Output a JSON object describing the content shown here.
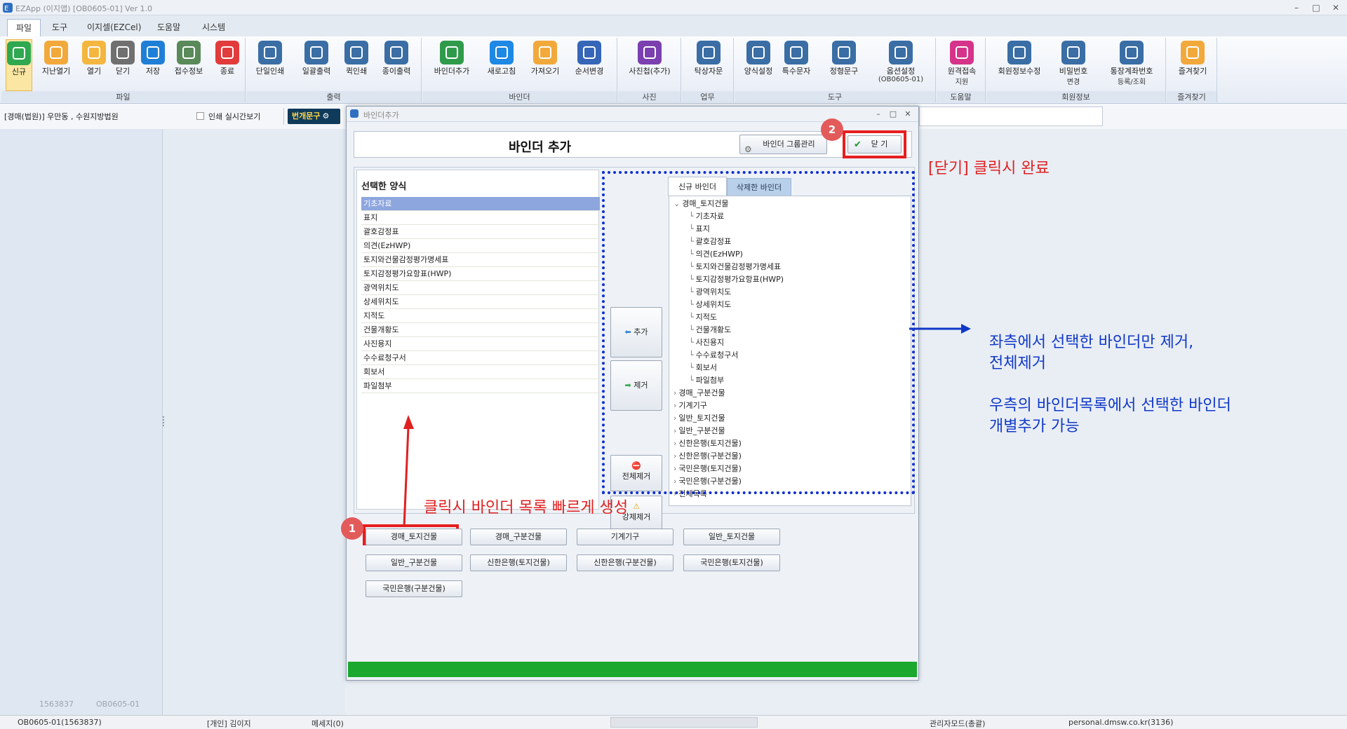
{
  "window": {
    "title": "EZApp (이지앱) [OB0605-01] Ver 1.0",
    "min": "–",
    "max": "□",
    "close": "✕"
  },
  "menu": [
    "파일",
    "도구",
    "이지셀(EZCel)",
    "도움말",
    "시스템"
  ],
  "ribbon": {
    "groups": [
      "파일",
      "출력",
      "바인더",
      "사진",
      "업무",
      "도구",
      "도움말",
      "회원정보",
      "즐겨찾기"
    ],
    "buttons": [
      {
        "label": "신규",
        "icon": "plus-icon",
        "color": "#2fa84f"
      },
      {
        "label": "지난열기",
        "icon": "folder-history-icon",
        "color": "#f2a93b"
      },
      {
        "label": "열기",
        "icon": "folder-open-icon",
        "color": "#f4b63f"
      },
      {
        "label": "닫기",
        "icon": "close-x-icon",
        "color": "#707070"
      },
      {
        "label": "저장",
        "icon": "save-icon",
        "color": "#1f7fd6"
      },
      {
        "label": "접수정보",
        "icon": "receipt-icon",
        "color": "#5a8a5a"
      },
      {
        "label": "종료",
        "icon": "power-icon",
        "color": "#e23b3b"
      },
      {
        "label": "단일인쇄",
        "icon": "printer-icon",
        "color": "#3a6ea5"
      },
      {
        "label": "일괄출력",
        "icon": "printer-all-icon",
        "color": "#3a6ea5"
      },
      {
        "label": "퀵인쇄",
        "icon": "quick-print-icon",
        "color": "#3a6ea5"
      },
      {
        "label": "종이출력",
        "icon": "paper-print-icon",
        "color": "#3a6ea5"
      },
      {
        "label": "바인더추가",
        "icon": "binder-add-icon",
        "color": "#2f9b4a"
      },
      {
        "label": "새로고침",
        "icon": "refresh-icon",
        "color": "#1e88e5"
      },
      {
        "label": "가져오기",
        "icon": "import-arrow-icon",
        "color": "#f2a93b"
      },
      {
        "label": "순서변경",
        "icon": "reorder-icon",
        "color": "#3566b8"
      },
      {
        "label": "사진첩(추가)",
        "icon": "photo-album-icon",
        "color": "#7b3fb0"
      },
      {
        "label": "탁상자문",
        "icon": "people-icon",
        "color": "#3a6ea5"
      },
      {
        "label": "양식설정",
        "icon": "form-settings-icon",
        "color": "#3a6ea5"
      },
      {
        "label": "특수문자",
        "icon": "special-char-icon",
        "color": "#3a6ea5"
      },
      {
        "label": "정형문구",
        "icon": "template-text-icon",
        "color": "#3a6ea5"
      },
      {
        "label": "옵션설정",
        "sub": "(OB0605-01)",
        "icon": "option-settings-icon",
        "color": "#3a6ea5"
      },
      {
        "label": "원격접속",
        "sub": "지원",
        "icon": "remote-support-icon",
        "color": "#d6338a"
      },
      {
        "label": "회원정보수정",
        "icon": "member-edit-icon",
        "color": "#3a6ea5"
      },
      {
        "label": "비밀번호",
        "sub": "변경",
        "icon": "password-change-icon",
        "color": "#3a6ea5"
      },
      {
        "label": "통장계좌번호",
        "sub": "등록/조회",
        "icon": "bank-account-icon",
        "color": "#3a6ea5"
      },
      {
        "label": "즐겨찾기",
        "icon": "star-icon",
        "color": "#f2a93b"
      }
    ]
  },
  "info_row": {
    "case_text": "[경매(법원)] 우만동 , 수원지방법원",
    "realtime_print_label": "인쇄 실시간보기",
    "tag_button": "번개문구"
  },
  "left_panel": {
    "footer_left": "1563837",
    "footer_right": "OB0605-01"
  },
  "status_bar": [
    "OB0605-01(1563837)",
    "[개인] 김이지",
    "메세지(0)",
    "관리자모드(총괄)",
    "personal.dmsw.co.kr(3136)"
  ],
  "dialog": {
    "window_title": "바인더추가",
    "header_title": "바인더 추가",
    "group_manage_button": "바인더 그룹관리",
    "close_button": "닫   기",
    "selected_forms_title": "선택한 양식",
    "selected_forms": [
      "기초자료",
      "표지",
      "괄호감정표",
      "의견(EzHWP)",
      "토지와건물감정평가명세표",
      "토지감정평가요항표(HWP)",
      "광역위치도",
      "상세위치도",
      "지적도",
      "건물개황도",
      "사진용지",
      "수수료청구서",
      "회보서",
      "파일첨부"
    ],
    "add_button": "추가",
    "remove_button": "제거",
    "remove_all_button": "전체제거",
    "force_remove_button": "강제제거",
    "tabs": [
      "신규 바인더",
      "삭제한 바인더"
    ],
    "tree_root": "경매_토지건물",
    "tree_children": [
      "기초자료",
      "표지",
      "괄호감정표",
      "의견(EzHWP)",
      "토지와건물감정평가명세표",
      "토지감정평가요항표(HWP)",
      "광역위치도",
      "상세위치도",
      "지적도",
      "건물개황도",
      "사진용지",
      "수수료청구서",
      "회보서",
      "파일첨부"
    ],
    "tree_collapsed": [
      "경매_구분건물",
      "기계기구",
      "일반_토지건물",
      "일반_구분건물",
      "신한은행(토지건물)",
      "신한은행(구분건물)",
      "국민은행(토지건물)",
      "국민은행(구분건물)",
      "전체목록"
    ],
    "quick_buttons": [
      "경매_토지건물",
      "경매_구분건물",
      "기계기구",
      "일반_토지건물",
      "일반_구분건물",
      "신한은행(토지건물)",
      "신한은행(구분건물)",
      "국민은행(토지건물)",
      "국민은행(구분건물)"
    ]
  },
  "annotations": {
    "badge1": "1",
    "badge2": "2",
    "close_note": "[닫기] 클릭시 완료",
    "click_note": "클릭시 바인더 목록 빠르게 생성",
    "right_note_line1": "좌측에서 선택한 바인더만 제거,",
    "right_note_line2": "전체제거",
    "right_note_line3": "우측의 바인더목록에서 선택한 바인더",
    "right_note_line4": "개별추가 가능"
  },
  "colors": {
    "accent_red": "#e02020",
    "accent_blue": "#1038c8",
    "progress_green": "#1aa82e",
    "selection": "#8ea6de"
  }
}
